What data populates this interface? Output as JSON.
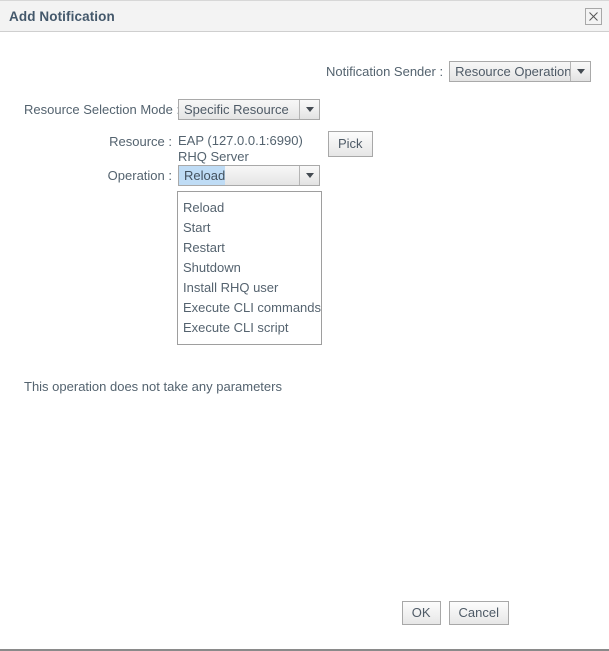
{
  "window": {
    "title": "Add Notification",
    "close_icon": "close-icon"
  },
  "form": {
    "sender": {
      "label": "Notification Sender :",
      "value": "Resource Operations"
    },
    "selection_mode": {
      "label": "Resource Selection Mode :",
      "value": "Specific Resource"
    },
    "resource": {
      "label": "Resource :",
      "value": "EAP (127.0.0.1:6990) RHQ Server",
      "pick_label": "Pick"
    },
    "operation": {
      "label": "Operation :",
      "value": "Reload",
      "options": [
        "Reload",
        "Start",
        "Restart",
        "Shutdown",
        "Install RHQ user",
        "Execute CLI commands",
        "Execute CLI script"
      ]
    },
    "parameters_note": "This operation does not take any parameters"
  },
  "footer": {
    "ok_label": "OK",
    "cancel_label": "Cancel"
  },
  "colors": {
    "title_text": "#44586b",
    "body_text": "#54636f",
    "titlebar_bg": "#f3f3f3",
    "selection_highlight": "#bfdcf5"
  }
}
